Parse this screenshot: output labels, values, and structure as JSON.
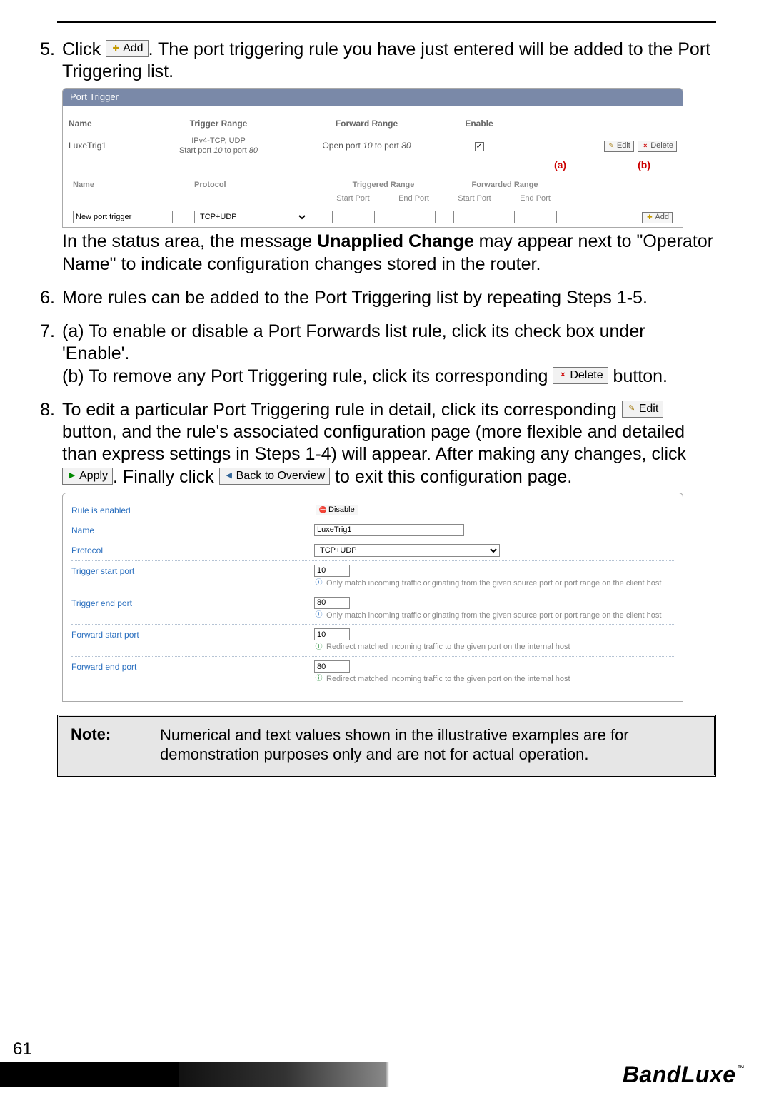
{
  "step5": {
    "num": "5.",
    "pre": "Click ",
    "btn_add": "Add",
    "post": ". The port triggering rule you have just entered will be added to the Port Triggering list."
  },
  "pt_panel": {
    "title": "Port Trigger",
    "headers": {
      "name": "Name",
      "trigger": "Trigger Range",
      "forward": "Forward Range",
      "enable": "Enable"
    },
    "row": {
      "name": "LuxeTrig1",
      "trig_l1": "IPv4-TCP, UDP",
      "trig_l2_a": "Start port ",
      "trig_l2_b": "10",
      "trig_l2_c": " to port ",
      "trig_l2_d": "80",
      "fwd_a": "Open port ",
      "fwd_b": "10",
      "fwd_c": " to port ",
      "fwd_d": "80",
      "edit": "Edit",
      "delete": "Delete"
    },
    "ab": {
      "a": "(a)",
      "b": "(b)"
    },
    "sub_headers": {
      "name": "Name",
      "protocol": "Protocol",
      "trig_range": "Triggered Range",
      "fwd_range": "Forwarded Range",
      "start": "Start Port",
      "end": "End Port"
    },
    "sub_row": {
      "name_value": "New port trigger",
      "proto_value": "TCP+UDP",
      "add": "Add"
    }
  },
  "step5b": {
    "a": "In the status area, the message ",
    "b": "Unapplied Change",
    "c": " may appear next to \"Operator Name\" to indicate configuration changes stored in the router."
  },
  "step6": {
    "num": "6.",
    "text": "More rules can be added to the Port Triggering list by repeating Steps 1-5."
  },
  "step7": {
    "num": "7.",
    "a": "(a) To enable or disable a Port Forwards list rule, click its check box under 'Enable'.",
    "b1": "(b) To remove any Port Triggering rule, click its corresponding ",
    "b_btn": "Delete",
    "b2": " button."
  },
  "step8": {
    "num": "8.",
    "a": "To edit a particular Port Triggering rule in detail, click its corresponding ",
    "edit_btn": "Edit",
    "b": " button, and the rule's associated configuration page (more flexible and detailed than express settings in Steps 1-4) will appear. After making any changes, click ",
    "apply_btn": "Apply",
    "c": ". Finally click ",
    "back_btn": "Back to Overview",
    "d": " to exit this configuration page."
  },
  "detail": {
    "rule_enabled": {
      "label": "Rule is enabled",
      "btn": "Disable"
    },
    "name": {
      "label": "Name",
      "value": "LuxeTrig1"
    },
    "protocol": {
      "label": "Protocol",
      "value": "TCP+UDP"
    },
    "tstart": {
      "label": "Trigger start port",
      "value": "10",
      "hint": "Only match incoming traffic originating from the given source port or port range on the client host"
    },
    "tend": {
      "label": "Trigger end port",
      "value": "80",
      "hint": "Only match incoming traffic originating from the given source port or port range on the client host"
    },
    "fstart": {
      "label": "Forward start port",
      "value": "10",
      "hint": "Redirect matched incoming traffic to the given port on the internal host"
    },
    "fend": {
      "label": "Forward end port",
      "value": "80",
      "hint": "Redirect matched incoming traffic to the given port on the internal host"
    }
  },
  "note": {
    "label": "Note:",
    "text": "Numerical and text values shown in the illustrative examples are for demonstration purposes only and are not for actual operation."
  },
  "footer": {
    "page": "61",
    "brand": "BandLuxe",
    "tm": "™"
  }
}
